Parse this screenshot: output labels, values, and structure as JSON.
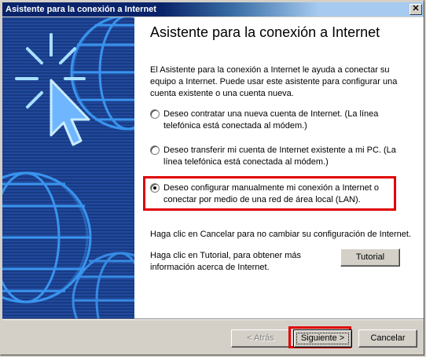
{
  "window": {
    "title": "Asistente para la conexión a Internet",
    "close_glyph": "✕"
  },
  "banner": {
    "icon": "globe-cursor-illustration",
    "colors": {
      "background": "#1a3d8a",
      "grid": "#3fa3ff",
      "pointer": "#a8e0ff"
    }
  },
  "content": {
    "heading": "Asistente para la conexión a Internet",
    "intro": "El Asistente para la conexión a Internet le ayuda a conectar su equipo a Internet. Puede usar este asistente para configurar una cuenta existente o una cuenta nueva.",
    "options": [
      {
        "label": "Deseo contratar una nueva cuenta de Internet. (La línea telefónica está conectada al módem.)",
        "selected": false
      },
      {
        "label": "Deseo transferir mi cuenta de Internet existente a mi PC. (La línea telefónica está conectada al módem.)",
        "selected": false
      },
      {
        "label": "Deseo configurar manualmente mi conexión a Internet o conectar por medio de una red de área local (LAN).",
        "selected": true
      }
    ],
    "cancel_text": "Haga clic en Cancelar para no cambiar su configuración de Internet.",
    "tutorial_text": "Haga clic en Tutorial, para obtener más información acerca de Internet.",
    "tutorial_button": "Tutorial"
  },
  "footer": {
    "back_button": "< Atrás",
    "next_button": "Siguiente >",
    "cancel_button": "Cancelar"
  },
  "annotation_color": "#e00000"
}
